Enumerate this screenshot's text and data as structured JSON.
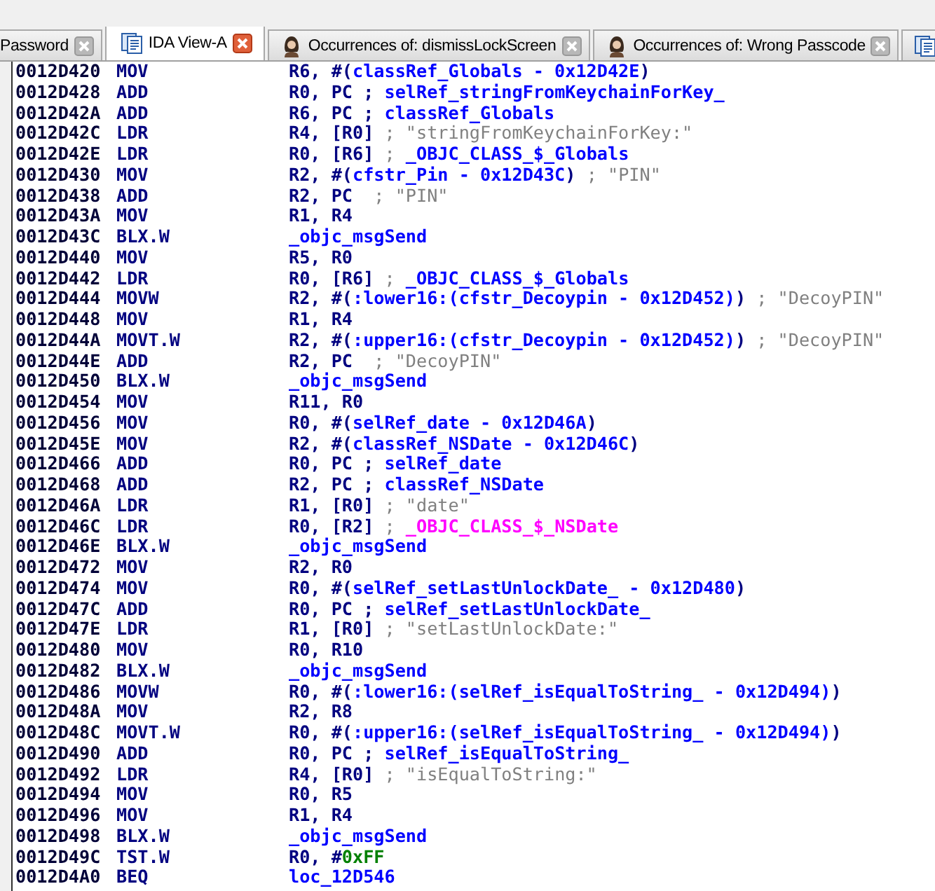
{
  "tabs": [
    {
      "label": "Password",
      "kind": "plain",
      "selected": false,
      "closable": true
    },
    {
      "label": "IDA View-A",
      "kind": "view",
      "selected": true,
      "closable": true
    },
    {
      "label": "Occurrences of: dismissLockScreen",
      "kind": "occurrences",
      "selected": false,
      "closable": true
    },
    {
      "label": "Occurrences of: Wrong Passcode",
      "kind": "occurrences",
      "selected": false,
      "closable": true
    },
    {
      "kind": "view",
      "selected": false,
      "closable": false
    }
  ],
  "listing": [
    {
      "address": "0012D420",
      "mnemonic": "MOV",
      "operands": [
        {
          "kind": "reg",
          "text": "R6, #("
        },
        {
          "kind": "name",
          "text": "classRef_Globals - 0x12D42E"
        },
        {
          "kind": "reg",
          "text": ")"
        }
      ]
    },
    {
      "address": "0012D428",
      "mnemonic": "ADD",
      "operands": [
        {
          "kind": "reg",
          "text": "R0, PC ; "
        },
        {
          "kind": "name",
          "text": "selRef_stringFromKeychainForKey_"
        }
      ]
    },
    {
      "address": "0012D42A",
      "mnemonic": "ADD",
      "operands": [
        {
          "kind": "reg",
          "text": "R6, PC ; "
        },
        {
          "kind": "name",
          "text": "classRef_Globals"
        }
      ]
    },
    {
      "address": "0012D42C",
      "mnemonic": "LDR",
      "operands": [
        {
          "kind": "reg",
          "text": "R4, [R0] "
        },
        {
          "kind": "comment",
          "text": "; \"stringFromKeychainForKey:\""
        }
      ]
    },
    {
      "address": "0012D42E",
      "mnemonic": "LDR",
      "operands": [
        {
          "kind": "reg",
          "text": "R0, [R6] "
        },
        {
          "kind": "comment",
          "text": "; "
        },
        {
          "kind": "name",
          "text": "_OBJC_CLASS_$_Globals"
        }
      ]
    },
    {
      "address": "0012D430",
      "mnemonic": "MOV",
      "operands": [
        {
          "kind": "reg",
          "text": "R2, #("
        },
        {
          "kind": "name",
          "text": "cfstr_Pin - 0x12D43C"
        },
        {
          "kind": "reg",
          "text": ") "
        },
        {
          "kind": "comment",
          "text": "; \"PIN\""
        }
      ]
    },
    {
      "address": "0012D438",
      "mnemonic": "ADD",
      "operands": [
        {
          "kind": "reg",
          "text": "R2, PC  "
        },
        {
          "kind": "comment",
          "text": "; \"PIN\""
        }
      ]
    },
    {
      "address": "0012D43A",
      "mnemonic": "MOV",
      "operands": [
        {
          "kind": "reg",
          "text": "R1, R4"
        }
      ]
    },
    {
      "address": "0012D43C",
      "mnemonic": "BLX.W",
      "operands": [
        {
          "kind": "name",
          "text": "_objc_msgSend"
        }
      ]
    },
    {
      "address": "0012D440",
      "mnemonic": "MOV",
      "operands": [
        {
          "kind": "reg",
          "text": "R5, R0"
        }
      ]
    },
    {
      "address": "0012D442",
      "mnemonic": "LDR",
      "operands": [
        {
          "kind": "reg",
          "text": "R0, [R6] "
        },
        {
          "kind": "comment",
          "text": "; "
        },
        {
          "kind": "name",
          "text": "_OBJC_CLASS_$_Globals"
        }
      ]
    },
    {
      "address": "0012D444",
      "mnemonic": "MOVW",
      "operands": [
        {
          "kind": "reg",
          "text": "R2, #("
        },
        {
          "kind": "name",
          "text": ":lower16:(cfstr_Decoypin - 0x12D452)"
        },
        {
          "kind": "reg",
          "text": ") "
        },
        {
          "kind": "comment",
          "text": "; \"DecoyPIN\""
        }
      ]
    },
    {
      "address": "0012D448",
      "mnemonic": "MOV",
      "operands": [
        {
          "kind": "reg",
          "text": "R1, R4"
        }
      ]
    },
    {
      "address": "0012D44A",
      "mnemonic": "MOVT.W",
      "operands": [
        {
          "kind": "reg",
          "text": "R2, #("
        },
        {
          "kind": "name",
          "text": ":upper16:(cfstr_Decoypin - 0x12D452)"
        },
        {
          "kind": "reg",
          "text": ") "
        },
        {
          "kind": "comment",
          "text": "; \"DecoyPIN\""
        }
      ]
    },
    {
      "address": "0012D44E",
      "mnemonic": "ADD",
      "operands": [
        {
          "kind": "reg",
          "text": "R2, PC  "
        },
        {
          "kind": "comment",
          "text": "; \"DecoyPIN\""
        }
      ]
    },
    {
      "address": "0012D450",
      "mnemonic": "BLX.W",
      "operands": [
        {
          "kind": "name",
          "text": "_objc_msgSend"
        }
      ]
    },
    {
      "address": "0012D454",
      "mnemonic": "MOV",
      "operands": [
        {
          "kind": "reg",
          "text": "R11, R0"
        }
      ]
    },
    {
      "address": "0012D456",
      "mnemonic": "MOV",
      "operands": [
        {
          "kind": "reg",
          "text": "R0, #("
        },
        {
          "kind": "name",
          "text": "selRef_date - 0x12D46A"
        },
        {
          "kind": "reg",
          "text": ")"
        }
      ]
    },
    {
      "address": "0012D45E",
      "mnemonic": "MOV",
      "operands": [
        {
          "kind": "reg",
          "text": "R2, #("
        },
        {
          "kind": "name",
          "text": "classRef_NSDate - 0x12D46C"
        },
        {
          "kind": "reg",
          "text": ")"
        }
      ]
    },
    {
      "address": "0012D466",
      "mnemonic": "ADD",
      "operands": [
        {
          "kind": "reg",
          "text": "R0, PC ; "
        },
        {
          "kind": "name",
          "text": "selRef_date"
        }
      ]
    },
    {
      "address": "0012D468",
      "mnemonic": "ADD",
      "operands": [
        {
          "kind": "reg",
          "text": "R2, PC ; "
        },
        {
          "kind": "name",
          "text": "classRef_NSDate"
        }
      ]
    },
    {
      "address": "0012D46A",
      "mnemonic": "LDR",
      "operands": [
        {
          "kind": "reg",
          "text": "R1, [R0] "
        },
        {
          "kind": "comment",
          "text": "; \"date\""
        }
      ]
    },
    {
      "address": "0012D46C",
      "mnemonic": "LDR",
      "operands": [
        {
          "kind": "reg",
          "text": "R0, [R2] "
        },
        {
          "kind": "comment",
          "text": "; "
        },
        {
          "kind": "import",
          "text": "_OBJC_CLASS_$_NSDate"
        }
      ]
    },
    {
      "address": "0012D46E",
      "mnemonic": "BLX.W",
      "operands": [
        {
          "kind": "name",
          "text": "_objc_msgSend"
        }
      ]
    },
    {
      "address": "0012D472",
      "mnemonic": "MOV",
      "operands": [
        {
          "kind": "reg",
          "text": "R2, R0"
        }
      ]
    },
    {
      "address": "0012D474",
      "mnemonic": "MOV",
      "operands": [
        {
          "kind": "reg",
          "text": "R0, #("
        },
        {
          "kind": "name",
          "text": "selRef_setLastUnlockDate_ - 0x12D480"
        },
        {
          "kind": "reg",
          "text": ")"
        }
      ]
    },
    {
      "address": "0012D47C",
      "mnemonic": "ADD",
      "operands": [
        {
          "kind": "reg",
          "text": "R0, PC ; "
        },
        {
          "kind": "name",
          "text": "selRef_setLastUnlockDate_"
        }
      ]
    },
    {
      "address": "0012D47E",
      "mnemonic": "LDR",
      "operands": [
        {
          "kind": "reg",
          "text": "R1, [R0] "
        },
        {
          "kind": "comment",
          "text": "; \"setLastUnlockDate:\""
        }
      ]
    },
    {
      "address": "0012D480",
      "mnemonic": "MOV",
      "operands": [
        {
          "kind": "reg",
          "text": "R0, R10"
        }
      ]
    },
    {
      "address": "0012D482",
      "mnemonic": "BLX.W",
      "operands": [
        {
          "kind": "name",
          "text": "_objc_msgSend"
        }
      ]
    },
    {
      "address": "0012D486",
      "mnemonic": "MOVW",
      "operands": [
        {
          "kind": "reg",
          "text": "R0, #("
        },
        {
          "kind": "name",
          "text": ":lower16:(selRef_isEqualToString_ - 0x12D494)"
        },
        {
          "kind": "reg",
          "text": ")"
        }
      ]
    },
    {
      "address": "0012D48A",
      "mnemonic": "MOV",
      "operands": [
        {
          "kind": "reg",
          "text": "R2, R8"
        }
      ]
    },
    {
      "address": "0012D48C",
      "mnemonic": "MOVT.W",
      "operands": [
        {
          "kind": "reg",
          "text": "R0, #("
        },
        {
          "kind": "name",
          "text": ":upper16:(selRef_isEqualToString_ - 0x12D494)"
        },
        {
          "kind": "reg",
          "text": ")"
        }
      ]
    },
    {
      "address": "0012D490",
      "mnemonic": "ADD",
      "operands": [
        {
          "kind": "reg",
          "text": "R0, PC ; "
        },
        {
          "kind": "name",
          "text": "selRef_isEqualToString_"
        }
      ]
    },
    {
      "address": "0012D492",
      "mnemonic": "LDR",
      "operands": [
        {
          "kind": "reg",
          "text": "R4, [R0] "
        },
        {
          "kind": "comment",
          "text": "; \"isEqualToString:\""
        }
      ]
    },
    {
      "address": "0012D494",
      "mnemonic": "MOV",
      "operands": [
        {
          "kind": "reg",
          "text": "R0, R5"
        }
      ]
    },
    {
      "address": "0012D496",
      "mnemonic": "MOV",
      "operands": [
        {
          "kind": "reg",
          "text": "R1, R4"
        }
      ]
    },
    {
      "address": "0012D498",
      "mnemonic": "BLX.W",
      "operands": [
        {
          "kind": "name",
          "text": "_objc_msgSend"
        }
      ]
    },
    {
      "address": "0012D49C",
      "mnemonic": "TST.W",
      "operands": [
        {
          "kind": "reg",
          "text": "R0, #"
        },
        {
          "kind": "imm",
          "text": "0xFF"
        }
      ]
    },
    {
      "address": "0012D4A0",
      "mnemonic": "BEQ",
      "operands": [
        {
          "kind": "name",
          "text": "loc_12D546"
        }
      ]
    }
  ]
}
